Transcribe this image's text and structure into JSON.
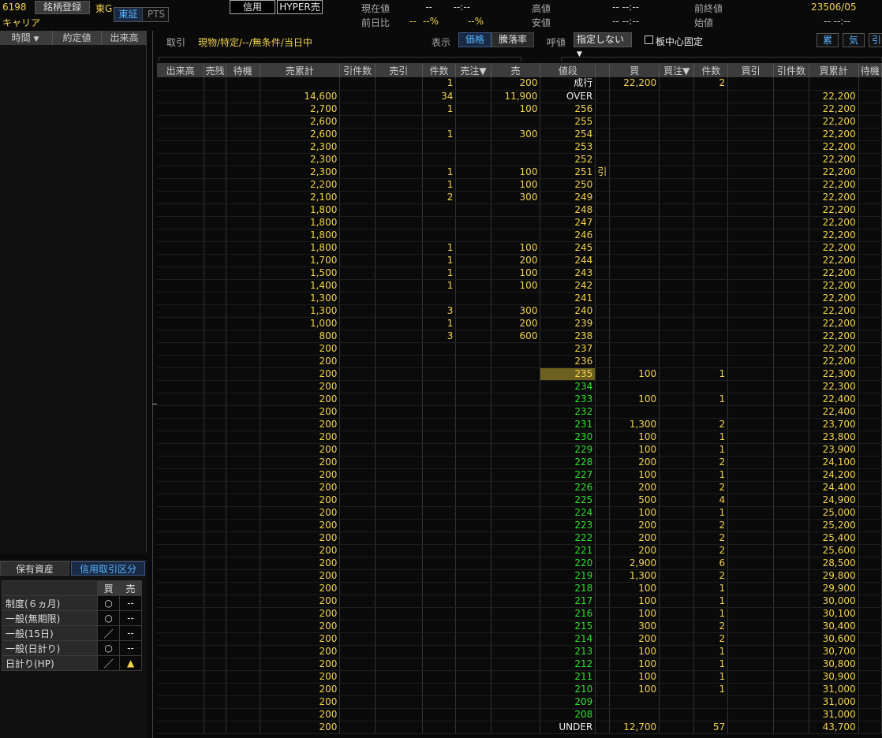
{
  "header": {
    "code": "6198",
    "register_label": "銘柄登録",
    "market": "東G",
    "name": "キャリア",
    "tabs": [
      "東証",
      "PTS"
    ],
    "credit_label": "信用",
    "hyper_label": "HYPER売",
    "stats": [
      {
        "label": "現在値",
        "value": "--",
        "time": "--:--"
      },
      {
        "label": "前日比",
        "value": "--",
        "pct": "--%",
        "pct2": "--%"
      },
      {
        "label": "高値",
        "value": "-- --:--"
      },
      {
        "label": "安値",
        "value": "-- --:--"
      },
      {
        "label": "前終値",
        "value": "235",
        "date": "06/05"
      },
      {
        "label": "始値",
        "value": "-- --:--"
      }
    ]
  },
  "ticks": {
    "columns": [
      "時間",
      "約定値",
      "出来高"
    ]
  },
  "order_bar": {
    "torihiki_label": "取引",
    "torihiki_value": "現物/特定/--/無条件/当日中",
    "display_label": "表示",
    "display_options": [
      "価格",
      "騰落率"
    ],
    "yobine_label": "呼値",
    "yobine_value": "指定しない",
    "center_lock_label": "板中心固定",
    "right_buttons": [
      "累",
      "気",
      "引"
    ]
  },
  "board": {
    "columns": [
      "出来高",
      "売残",
      "待機",
      "売累計",
      "引件数",
      "売引",
      "件数",
      "売注▼",
      "売",
      "値段",
      "",
      "買",
      "買注▼",
      "件数",
      "買引",
      "引件数",
      "買累計",
      "待機"
    ],
    "rows": [
      {
        "p": "成行",
        "c": "w",
        "sc": "1",
        "sell": "200",
        "buy": "22,200",
        "bc": "2"
      },
      {
        "p": "OVER",
        "c": "w",
        "scum": "14,600",
        "sc": "34",
        "sell": "11,900",
        "bcum": "22,200"
      },
      {
        "p": "256",
        "c": "r",
        "scum": "2,700",
        "sc": "1",
        "sell": "100",
        "bcum": "22,200"
      },
      {
        "p": "255",
        "c": "r",
        "scum": "2,600",
        "bcum": "22,200"
      },
      {
        "p": "254",
        "c": "r",
        "scum": "2,600",
        "sc": "1",
        "sell": "300",
        "bcum": "22,200"
      },
      {
        "p": "253",
        "c": "r",
        "scum": "2,300",
        "bcum": "22,200"
      },
      {
        "p": "252",
        "c": "r",
        "scum": "2,300",
        "bcum": "22,200"
      },
      {
        "p": "251",
        "c": "r",
        "scum": "2,300",
        "sc": "1",
        "sell": "100",
        "mk": "引",
        "bcum": "22,200"
      },
      {
        "p": "250",
        "c": "r",
        "scum": "2,200",
        "sc": "1",
        "sell": "100",
        "bcum": "22,200"
      },
      {
        "p": "249",
        "c": "r",
        "scum": "2,100",
        "sc": "2",
        "sell": "300",
        "bcum": "22,200"
      },
      {
        "p": "248",
        "c": "r",
        "scum": "1,800",
        "bcum": "22,200"
      },
      {
        "p": "247",
        "c": "r",
        "scum": "1,800",
        "bcum": "22,200"
      },
      {
        "p": "246",
        "c": "r",
        "scum": "1,800",
        "bcum": "22,200"
      },
      {
        "p": "245",
        "c": "r",
        "scum": "1,800",
        "sc": "1",
        "sell": "100",
        "bcum": "22,200"
      },
      {
        "p": "244",
        "c": "r",
        "scum": "1,700",
        "sc": "1",
        "sell": "200",
        "bcum": "22,200"
      },
      {
        "p": "243",
        "c": "r",
        "scum": "1,500",
        "sc": "1",
        "sell": "100",
        "bcum": "22,200"
      },
      {
        "p": "242",
        "c": "r",
        "scum": "1,400",
        "sc": "1",
        "sell": "100",
        "bcum": "22,200"
      },
      {
        "p": "241",
        "c": "r",
        "scum": "1,300",
        "bcum": "22,200"
      },
      {
        "p": "240",
        "c": "r",
        "scum": "1,300",
        "sc": "3",
        "sell": "300",
        "bcum": "22,200"
      },
      {
        "p": "239",
        "c": "r",
        "scum": "1,000",
        "sc": "1",
        "sell": "200",
        "bcum": "22,200"
      },
      {
        "p": "238",
        "c": "r",
        "scum": "800",
        "sc": "3",
        "sell": "600",
        "bcum": "22,200"
      },
      {
        "p": "237",
        "c": "r",
        "scum": "200",
        "bcum": "22,200"
      },
      {
        "p": "236",
        "c": "r",
        "scum": "200",
        "bcum": "22,200"
      },
      {
        "p": "235",
        "c": "cur",
        "scum": "200",
        "buy": "100",
        "bc": "1",
        "bcum": "22,300"
      },
      {
        "p": "234",
        "c": "g",
        "scum": "200",
        "bcum": "22,300"
      },
      {
        "p": "233",
        "c": "g",
        "scum": "200",
        "buy": "100",
        "bc": "1",
        "bcum": "22,400"
      },
      {
        "p": "232",
        "c": "g",
        "scum": "200",
        "bcum": "22,400"
      },
      {
        "p": "231",
        "c": "g",
        "scum": "200",
        "buy": "1,300",
        "bc": "2",
        "bcum": "23,700"
      },
      {
        "p": "230",
        "c": "g",
        "scum": "200",
        "buy": "100",
        "bc": "1",
        "bcum": "23,800"
      },
      {
        "p": "229",
        "c": "g",
        "scum": "200",
        "buy": "100",
        "bc": "1",
        "bcum": "23,900"
      },
      {
        "p": "228",
        "c": "g",
        "scum": "200",
        "buy": "200",
        "bc": "2",
        "bcum": "24,100"
      },
      {
        "p": "227",
        "c": "g",
        "scum": "200",
        "buy": "100",
        "bc": "1",
        "bcum": "24,200"
      },
      {
        "p": "226",
        "c": "g",
        "scum": "200",
        "buy": "200",
        "bc": "2",
        "bcum": "24,400"
      },
      {
        "p": "225",
        "c": "g",
        "scum": "200",
        "buy": "500",
        "bc": "4",
        "bcum": "24,900"
      },
      {
        "p": "224",
        "c": "g",
        "scum": "200",
        "buy": "100",
        "bc": "1",
        "bcum": "25,000"
      },
      {
        "p": "223",
        "c": "g",
        "scum": "200",
        "buy": "200",
        "bc": "2",
        "bcum": "25,200"
      },
      {
        "p": "222",
        "c": "g",
        "scum": "200",
        "buy": "200",
        "bc": "2",
        "bcum": "25,400"
      },
      {
        "p": "221",
        "c": "g",
        "scum": "200",
        "buy": "200",
        "bc": "2",
        "bcum": "25,600"
      },
      {
        "p": "220",
        "c": "g",
        "scum": "200",
        "buy": "2,900",
        "bc": "6",
        "bcum": "28,500"
      },
      {
        "p": "219",
        "c": "g",
        "scum": "200",
        "buy": "1,300",
        "bc": "2",
        "bcum": "29,800"
      },
      {
        "p": "218",
        "c": "g",
        "scum": "200",
        "buy": "100",
        "bc": "1",
        "bcum": "29,900"
      },
      {
        "p": "217",
        "c": "g",
        "scum": "200",
        "buy": "100",
        "bc": "1",
        "bcum": "30,000"
      },
      {
        "p": "216",
        "c": "g",
        "scum": "200",
        "buy": "100",
        "bc": "1",
        "bcum": "30,100"
      },
      {
        "p": "215",
        "c": "g",
        "scum": "200",
        "buy": "300",
        "bc": "2",
        "bcum": "30,400"
      },
      {
        "p": "214",
        "c": "g",
        "scum": "200",
        "buy": "200",
        "bc": "2",
        "bcum": "30,600"
      },
      {
        "p": "213",
        "c": "g",
        "scum": "200",
        "buy": "100",
        "bc": "1",
        "bcum": "30,700"
      },
      {
        "p": "212",
        "c": "g",
        "scum": "200",
        "buy": "100",
        "bc": "1",
        "bcum": "30,800"
      },
      {
        "p": "211",
        "c": "g",
        "scum": "200",
        "buy": "100",
        "bc": "1",
        "bcum": "30,900"
      },
      {
        "p": "210",
        "c": "g",
        "scum": "200",
        "buy": "100",
        "bc": "1",
        "bcum": "31,000"
      },
      {
        "p": "209",
        "c": "g",
        "scum": "200",
        "bcum": "31,000"
      },
      {
        "p": "208",
        "c": "g",
        "scum": "200",
        "bcum": "31,000"
      },
      {
        "p": "UNDER",
        "c": "w",
        "scum": "200",
        "buy": "12,700",
        "bc": "57",
        "bcum": "43,700"
      }
    ]
  },
  "margin": {
    "tabs": [
      "保有資産",
      "信用取引区分"
    ],
    "head": [
      "買",
      "売"
    ],
    "rows": [
      {
        "label": "制度(６ヵ月)",
        "buy": "○",
        "sell": "--"
      },
      {
        "label": "一般(無期限)",
        "buy": "○",
        "sell": "--"
      },
      {
        "label": "一般(15日)",
        "buy": "／",
        "sell": "--"
      },
      {
        "label": "一般(日計り)",
        "buy": "○",
        "sell": "--"
      },
      {
        "label": "日計り(HP)",
        "buy": "／",
        "sell": "▲"
      }
    ]
  },
  "colors": {
    "sell_price": "#ee2b22",
    "buy_price": "#2fe02f",
    "value": "#f2d450",
    "accent": "#58b4ff"
  }
}
